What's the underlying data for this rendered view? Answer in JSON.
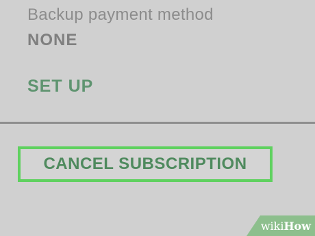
{
  "payment": {
    "backup_label": "Backup payment method",
    "backup_value": "NONE",
    "setup_label": "SET UP"
  },
  "subscription": {
    "cancel_label": "CANCEL SUBSCRIPTION"
  },
  "watermark": {
    "prefix": "wiki",
    "suffix": "How"
  },
  "colors": {
    "background": "#d0d0d0",
    "accent_green": "#5f9470",
    "highlight_border": "#5fd15f",
    "divider": "#8e8e8e"
  }
}
